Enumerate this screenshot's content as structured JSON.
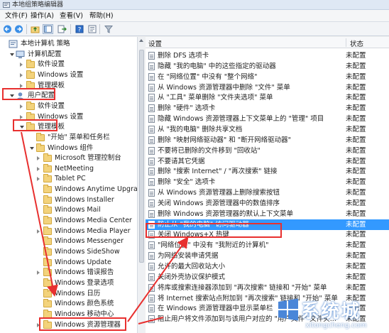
{
  "window": {
    "title": "本地组策略编辑器",
    "icon": "policy-editor-icon"
  },
  "menu": [
    "文件(F)",
    "操作(A)",
    "查看(V)",
    "帮助(H)"
  ],
  "toolbar": {
    "buttons": [
      "back-arrow-icon",
      "forward-arrow-icon",
      "up-folder-icon",
      "show-hide-tree-icon",
      "export-list-icon",
      "help-icon",
      "properties-icon",
      "filter-icon"
    ]
  },
  "tree": [
    {
      "label": "本地计算机 策略",
      "level": 0,
      "expander": "none",
      "icon": "computer-policy-icon"
    },
    {
      "label": "计算机配置",
      "level": 1,
      "expander": "open",
      "icon": "computer-icon"
    },
    {
      "label": "软件设置",
      "level": 2,
      "expander": "closed",
      "icon": "folder-icon"
    },
    {
      "label": "Windows 设置",
      "level": 2,
      "expander": "closed",
      "icon": "folder-icon"
    },
    {
      "label": "管理模板",
      "level": 2,
      "expander": "closed",
      "icon": "folder-icon"
    },
    {
      "label": "用户配置",
      "level": 1,
      "expander": "open",
      "icon": "user-config-icon"
    },
    {
      "label": "软件设置",
      "level": 2,
      "expander": "closed",
      "icon": "folder-icon"
    },
    {
      "label": "Windows 设置",
      "level": 2,
      "expander": "closed",
      "icon": "folder-icon"
    },
    {
      "label": "管理模板",
      "level": 2,
      "expander": "open",
      "icon": "folder-icon"
    },
    {
      "label": "\"开始\" 菜单和任务栏",
      "level": 3,
      "expander": "none",
      "icon": "folder-icon"
    },
    {
      "label": "Windows 组件",
      "level": 3,
      "expander": "open",
      "icon": "folder-icon"
    },
    {
      "label": "Microsoft 管理控制台",
      "level": 4,
      "expander": "closed",
      "icon": "folder-icon"
    },
    {
      "label": "NetMeeting",
      "level": 4,
      "expander": "closed",
      "icon": "folder-icon"
    },
    {
      "label": "Tablet PC",
      "level": 4,
      "expander": "closed",
      "icon": "folder-icon"
    },
    {
      "label": "Windows Anytime Upgrade",
      "level": 4,
      "expander": "none",
      "icon": "folder-icon"
    },
    {
      "label": "Windows Installer",
      "level": 4,
      "expander": "none",
      "icon": "folder-icon"
    },
    {
      "label": "Windows Mail",
      "level": 4,
      "expander": "none",
      "icon": "folder-icon"
    },
    {
      "label": "Windows Media Center",
      "level": 4,
      "expander": "none",
      "icon": "folder-icon"
    },
    {
      "label": "Windows Media Player",
      "level": 4,
      "expander": "closed",
      "icon": "folder-icon"
    },
    {
      "label": "Windows Messenger",
      "level": 4,
      "expander": "none",
      "icon": "folder-icon"
    },
    {
      "label": "Windows SideShow",
      "level": 4,
      "expander": "none",
      "icon": "folder-icon"
    },
    {
      "label": "Windows Update",
      "level": 4,
      "expander": "none",
      "icon": "folder-icon"
    },
    {
      "label": "Windows 错误报告",
      "level": 4,
      "expander": "closed",
      "icon": "folder-icon"
    },
    {
      "label": "Windows 登录选项",
      "level": 4,
      "expander": "none",
      "icon": "folder-icon"
    },
    {
      "label": "Windows 日历",
      "level": 4,
      "expander": "none",
      "icon": "folder-icon"
    },
    {
      "label": "Windows 颜色系统",
      "level": 4,
      "expander": "none",
      "icon": "folder-icon"
    },
    {
      "label": "Windows 移动中心",
      "level": 4,
      "expander": "none",
      "icon": "folder-icon"
    },
    {
      "label": "Windows 资源管理器",
      "level": 4,
      "expander": "closed",
      "icon": "folder-icon"
    }
  ],
  "list": {
    "header_setting": "设置",
    "header_state": "状态",
    "rows": [
      {
        "name": "删除 DFS 选项卡",
        "state": "未配置"
      },
      {
        "name": "隐藏 \"我的电脑\" 中的这些指定的驱动器",
        "state": "未配置"
      },
      {
        "name": "在 \"网络位置\" 中没有 \"整个网络\"",
        "state": "未配置"
      },
      {
        "name": "从 Windows 资源管理器中删除 \"文件\" 菜单",
        "state": "未配置"
      },
      {
        "name": "从 \"工具\" 菜单删除 \"文件夹选项\" 菜单",
        "state": "未配置"
      },
      {
        "name": "删除 \"硬件\" 选项卡",
        "state": "未配置"
      },
      {
        "name": "隐藏 Windows 资源管理器上下文菜单上的 \"管理\" 项目",
        "state": "未配置"
      },
      {
        "name": "从 \"我的电脑\" 删除共享文档",
        "state": "未配置"
      },
      {
        "name": "删除 \"映射网络驱动器\" 和 \"断开网络驱动器\"",
        "state": "未配置"
      },
      {
        "name": "不要将已删除的文件移到 \"回收站\"",
        "state": "未配置"
      },
      {
        "name": "不要请其它凭据",
        "state": "未配置"
      },
      {
        "name": "删除 \"搜索 Internet\" / \"再次搜索\" 链接",
        "state": "未配置"
      },
      {
        "name": "删除 \"安全\" 选项卡",
        "state": "未配置"
      },
      {
        "name": "从 Windows 资源管理器上删除搜索按钮",
        "state": "未配置"
      },
      {
        "name": "关闭 Windows 资源管理器中的数值排序",
        "state": "未配置"
      },
      {
        "name": "删除 Windows 资源管理器的默认上下文菜单",
        "state": "未配置"
      },
      {
        "name": "防止从 \"我的电脑\" 访问驱动器",
        "state": "未配置"
      },
      {
        "name": "关闭 Windows+X 热键",
        "state": "未配置"
      },
      {
        "name": "\"网络位置\" 中没有 \"我附近的计算机\"",
        "state": "未配置"
      },
      {
        "name": "为网络安装申请凭据",
        "state": "未配置"
      },
      {
        "name": "允许的最大回收站大小",
        "state": "未配置"
      },
      {
        "name": "关闭外壳协议保护模式",
        "state": "未配置"
      },
      {
        "name": "将库或搜索连接器添加到 \"再次搜索\" 链接和 \"开始\" 菜单",
        "state": "未配置"
      },
      {
        "name": "将 Internet 搜索站点附加到 \"再次搜索\" 链接和 \"开始\" 菜单",
        "state": "未配置"
      },
      {
        "name": "在 Windows 资源管理器中显示菜单栏",
        "state": "未配置"
      },
      {
        "name": "阻止用户将文件添加到与该用户对应的 \"用户文件\" 文件夹...",
        "state": "未配置"
      }
    ],
    "selected_index": 16
  },
  "colors": {
    "highlight_red": "#e8302f",
    "selection_blue": "#3399ff"
  },
  "watermark": {
    "text": "系统城",
    "url": "xitongcheng.com"
  }
}
